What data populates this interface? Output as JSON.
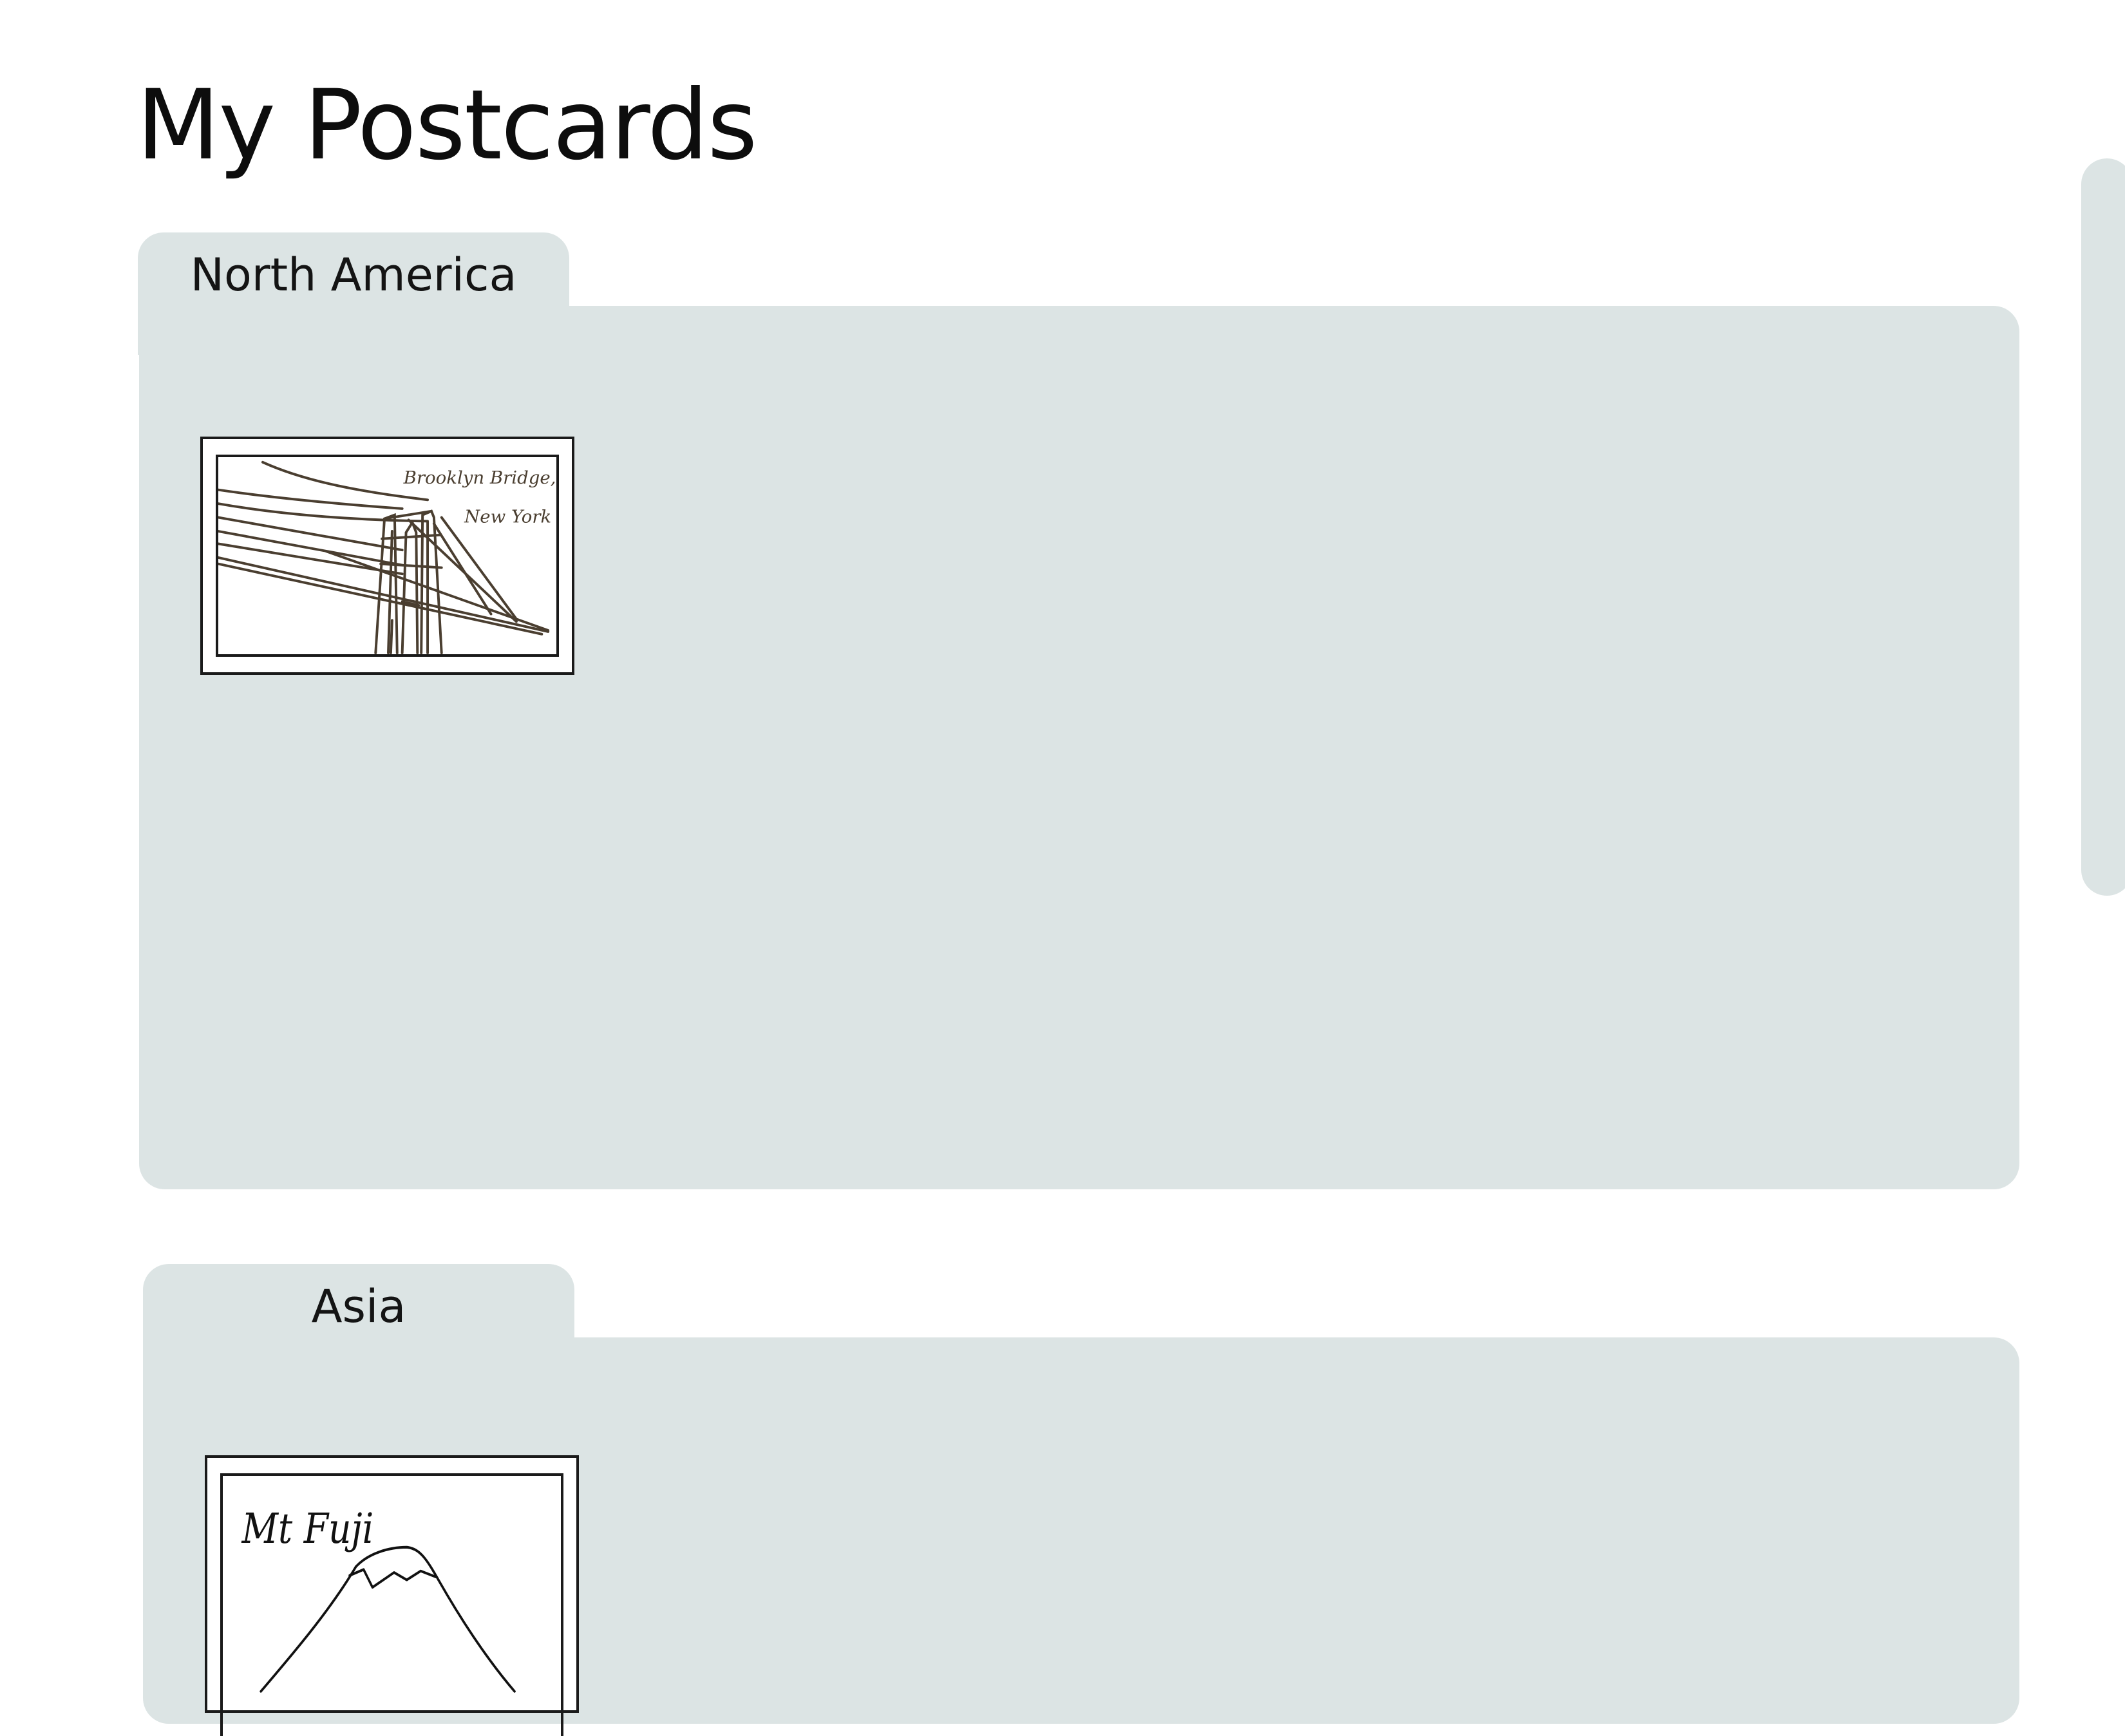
{
  "page": {
    "title": "My Postcards"
  },
  "colors": {
    "folder_background": "#dce4e4",
    "page_background": "#ffffff",
    "sketch_stroke": "#4a3e30",
    "text": "#111111"
  },
  "folders": [
    {
      "tab_label": "North America",
      "postcards": [
        {
          "caption_line1": "Brooklyn Bridge,",
          "caption_line2": "New York",
          "illustration": "brooklyn-bridge-sketch"
        }
      ]
    },
    {
      "tab_label": "Asia",
      "postcards": [
        {
          "caption_line1": "Mt Fuji",
          "illustration": "mount-fuji-sketch"
        }
      ]
    }
  ]
}
